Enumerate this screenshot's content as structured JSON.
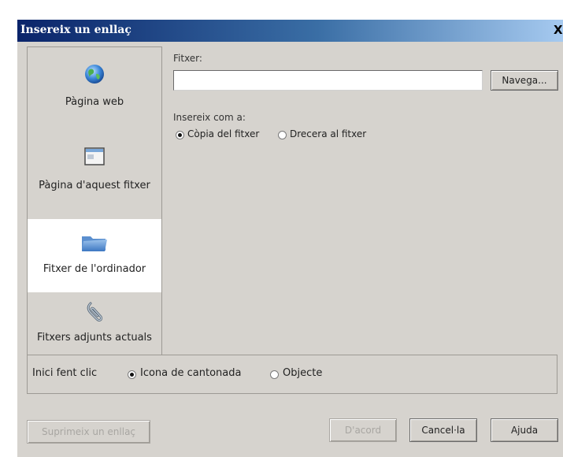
{
  "dialog": {
    "title": "Insereix un enllaç",
    "close_label": "X"
  },
  "nav": {
    "items": [
      {
        "label": "Pàgina web",
        "icon": "globe-icon",
        "selected": false
      },
      {
        "label": "Pàgina d'aquest fitxer",
        "icon": "page-icon",
        "selected": false
      },
      {
        "label": "Fitxer de l'ordinador",
        "icon": "folder-icon",
        "selected": true
      },
      {
        "label": "Fitxers adjunts actuals",
        "icon": "paperclip-icon",
        "selected": false
      }
    ]
  },
  "file": {
    "label": "Fitxer:",
    "value": "",
    "browse_label": "Navega..."
  },
  "insert_as": {
    "label": "Insereix com a:",
    "options": [
      {
        "label": "Còpia del fitxer",
        "checked": true
      },
      {
        "label": "Drecera al fitxer",
        "checked": false
      }
    ]
  },
  "start_click": {
    "label": "Inici fent clic",
    "options": [
      {
        "label": "Icona de cantonada",
        "checked": true
      },
      {
        "label": "Objecte",
        "checked": false
      }
    ]
  },
  "buttons": {
    "remove_link": "Suprimeix un enllaç",
    "ok": "D'acord",
    "cancel": "Cancel·la",
    "help": "Ajuda"
  }
}
